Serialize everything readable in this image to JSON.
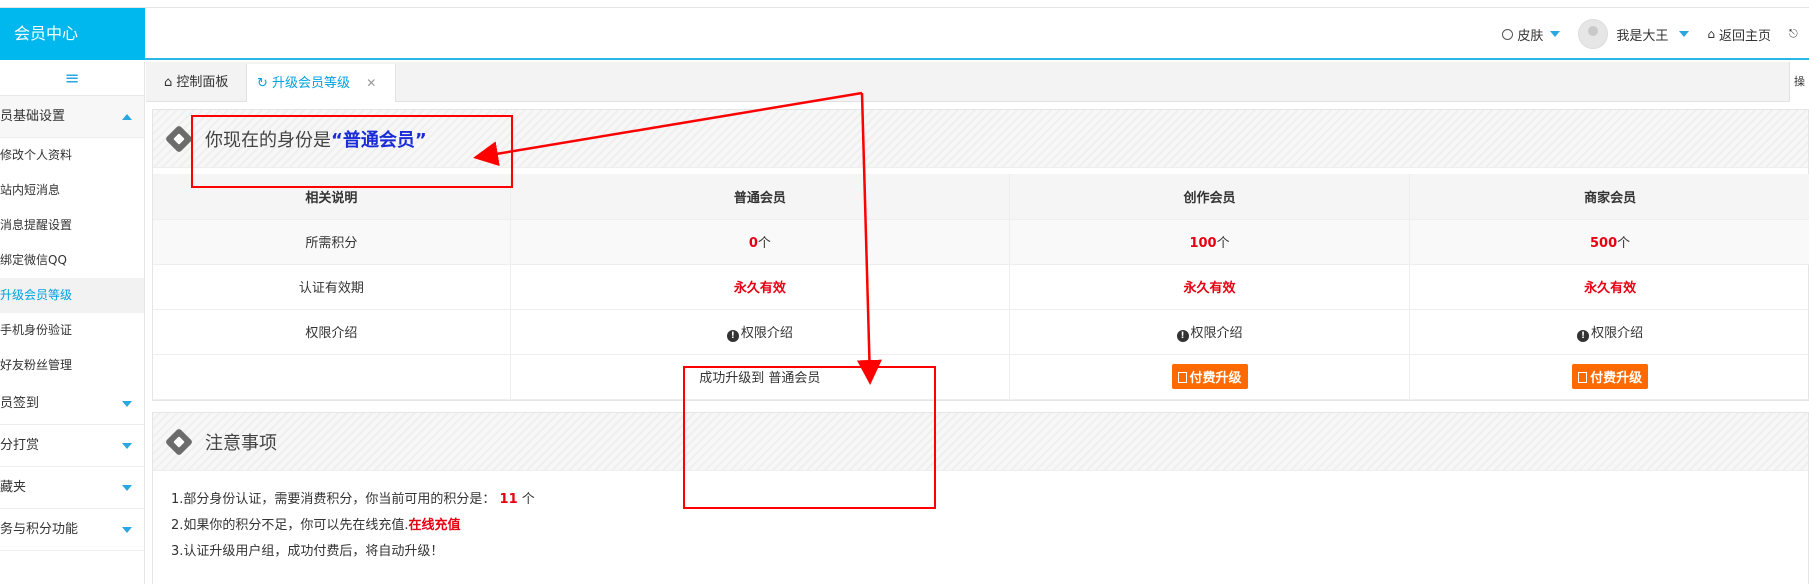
{
  "header": {
    "brand": "会员中心",
    "skin_label": "皮肤",
    "user_name": "我是大王",
    "home_label": "返回主页"
  },
  "sidebar": {
    "toggle_icon": "menu-icon",
    "groups": [
      {
        "label": "员基础设置",
        "expanded": true
      },
      {
        "label": "员签到",
        "expanded": false
      },
      {
        "label": "分打赏",
        "expanded": false
      },
      {
        "label": "藏夹",
        "expanded": false
      },
      {
        "label": "务与积分功能",
        "expanded": false
      }
    ],
    "items": [
      {
        "label": "修改个人资料"
      },
      {
        "label": "站内短消息"
      },
      {
        "label": "消息提醒设置"
      },
      {
        "label": "绑定微信QQ"
      },
      {
        "label": "升级会员等级",
        "active": true
      },
      {
        "label": "手机身份验证"
      },
      {
        "label": "好友粉丝管理"
      }
    ]
  },
  "tabs": [
    {
      "label": "控制面板",
      "icon": "home-icon"
    },
    {
      "label": "升级会员等级",
      "icon": "refresh-icon",
      "active": true,
      "closable": true
    }
  ],
  "tab_end_label": "操",
  "identity_panel": {
    "prefix": "你现在的身份是",
    "open_quote": "“",
    "level": "普通会员",
    "close_quote": "”"
  },
  "levels_table": {
    "headers": [
      "相关说明",
      "普通会员",
      "创作会员",
      "商家会员"
    ],
    "rows": {
      "points_label": "所需积分",
      "points": [
        "0",
        "100",
        "500"
      ],
      "points_unit": "个",
      "validity_label": "认证有效期",
      "validity": [
        "永久有效",
        "永久有效",
        "永久有效"
      ],
      "perm_label": "权限介绍",
      "perm": [
        "权限介绍",
        "权限介绍",
        "权限介绍"
      ],
      "current_status": "成功升级到 普通会员",
      "pay_label": "付费升级"
    }
  },
  "notes_panel": {
    "title": "注意事项",
    "line1_text": "1.部分身份认证，需要消费积分，你当前可用的积分是：",
    "line1_points": "11",
    "line1_unit": "个",
    "line2_text": "2.如果你的积分不足，你可以先在线充值.",
    "line2_link": "在线充值",
    "line3_text": "3.认证升级用户组，成功付费后，将自动升级！"
  },
  "colors": {
    "brand_bg": "#00b7ee",
    "accent": "#2aa7e0",
    "highlight_red": "#e60012",
    "pay_button": "#ff6a00",
    "annotation": "#ff0000",
    "level_blue": "#1a2bd8"
  }
}
